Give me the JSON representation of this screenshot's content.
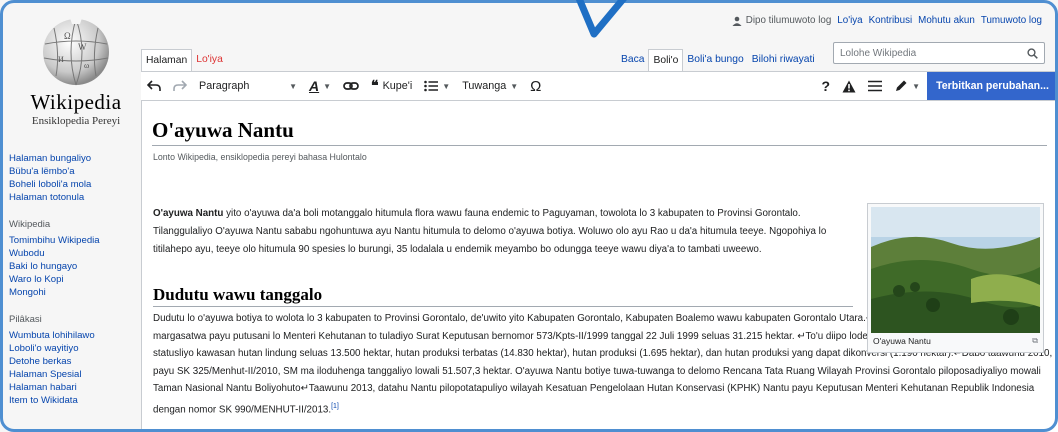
{
  "logo": {
    "wordmark": "Wikipedia",
    "tagline": "Ensiklopedia Pereyi"
  },
  "personal_tools": {
    "user": "Dipo tilumuwoto log",
    "links": [
      "Lo'iya",
      "Kontribusi",
      "Mohutu akun",
      "Tumuwoto log"
    ]
  },
  "sidebar": {
    "main": [
      "Halaman bungaliyo",
      "Bübu'a lëmbo'a",
      "Boheli loboli'a mola",
      "Halaman totonula"
    ],
    "wikipedia": {
      "heading": "Wikipedia",
      "links": [
        "Tomimbihu Wikipedia",
        "Wubodu",
        "Baki lo hungayo",
        "Waro lo Kopi",
        "Mongohi"
      ]
    },
    "tools": {
      "heading": "Pilâkasi",
      "links": [
        "Wumbuta lohihilawo",
        "Loboli'o wayitiyo",
        "Detohe berkas",
        "Halaman Spesial",
        "Halaman habari",
        "Item to Wikidata"
      ]
    }
  },
  "tabs": {
    "left": [
      "Halaman",
      "Lo'iya"
    ],
    "right": [
      "Baca",
      "Boli'o",
      "Boli'a bungo",
      "Bilohi riwayati"
    ]
  },
  "search": {
    "placeholder": "Lolohe Wikipedia",
    "icon": "search-icon"
  },
  "toolbar": {
    "paragraph": "Paragraph",
    "cite": "Kupe'i",
    "insert": "Tuwanga",
    "publish": "Terbitkan perubahan..."
  },
  "article": {
    "title": "O'ayuwa Nantu",
    "tagline": "Lonto Wikipedia, ensiklopedia pereyi bahasa Hulontalo",
    "lead_bold": "O'ayuwa Nantu",
    "lead_rest": " yito o'ayuwa da'a boli motanggalo hitumula flora wawu fauna endemic to Paguyaman, towolota lo 3 kabupaten to Provinsi Gorontalo. Tilanggulaliyo O'ayuwa Nantu sababu ngohuntuwa ayu Nantu hitumula to delomo o'ayuwa botiya. Woluwo olo ayu Rao u da'a hitumula teeye. Ngopohiya lo titilahepo ayu, teeye olo hitumula 90 spesies lo burungi, 35 lodalala u endemik meyambo bo odungga teeye wawu diya'a to tambati uweewo.",
    "section_heading": "Dudutu wawu tanggalo",
    "section_text": "Dudutu lo o'ayuwa botiya to wolota lo 3 kabupaten to Provinsi Gorontalo, de'uwito yito Kabupaten Gorontalo, Kabupaten Boalemo wawu kabupaten Gorontalo Utara.↵O'ayuwa Nantu ma lowali Suaka margasatwa payu putusani lo Menteri Kehutanan to tuladiyo Surat Keputusan bernomor 573/Kpts-II/1999 tanggal 22 Juli 1999 seluas 31.215 hektar. ↵To'u diipo lodehu putusani botiye, o'ayuwa Nantu statusliyo kawasan hutan lindung seluas 13.500 hektar, hutan produksi terbatas (14.830 hektar), hutan produksi (1.695 hektar), dan hutan produksi yang dapat dikonversi (1.190 hektar).↵Dabo taawunu 2010, payu SK 325/Menhut-II/2010, SM ma iloduhenga tanggaliyo lowali 51.507,3 hektar. O'ayuwa Nantu botiye tuwa-tuwanga to delomo Rencana Tata Ruang Wilayah Provinsi Gorontalo piloposadiyaliyo mowali Taman Nasional Nantu Boliyohuto↵Taawunu 2013, datahu Nantu pilopotatapuliyo wilayah Kesatuan Pengelolaan Hutan Konservasi (KPHK) Nantu payu Keputusan Menteri Kehutanan Republik Indonesia dengan nomor SK 990/MENHUT-II/2013.",
    "citation": "[1]",
    "image_caption": "O'ayuwa Nantu"
  },
  "colors": {
    "link": "#0645ad",
    "publish": "#3366cc",
    "frame": "#4f8fd1"
  }
}
